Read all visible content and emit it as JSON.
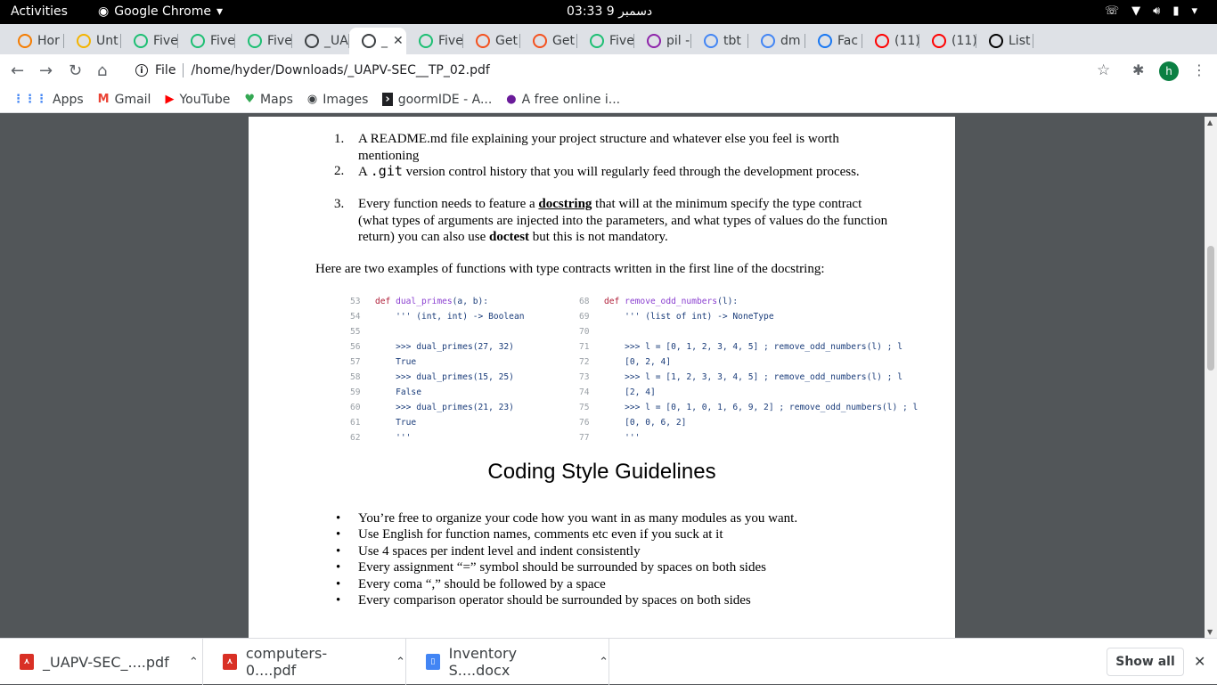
{
  "system": {
    "activities": "Activities",
    "app_name": "Google Chrome",
    "clock": "03:33 9 دسمبر"
  },
  "tabs": [
    {
      "label": "Hor",
      "color": "#f57c00"
    },
    {
      "label": "Unt",
      "color": "#f4b400"
    },
    {
      "label": "Five",
      "color": "#1dbf73"
    },
    {
      "label": "Five",
      "color": "#1dbf73"
    },
    {
      "label": "Five",
      "color": "#1dbf73"
    },
    {
      "label": "_UA",
      "color": "#3c4043"
    },
    {
      "label": "_",
      "color": "#3c4043"
    },
    {
      "label": "Five",
      "color": "#1dbf73"
    },
    {
      "label": "Get",
      "color": "#f4511e"
    },
    {
      "label": "Get",
      "color": "#f4511e"
    },
    {
      "label": "Five",
      "color": "#1dbf73"
    },
    {
      "label": "pil -",
      "color": "#8e24aa"
    },
    {
      "label": "tbt",
      "color": "#4285f4"
    },
    {
      "label": "dm",
      "color": "#4285f4"
    },
    {
      "label": "Fac",
      "color": "#1877f2"
    },
    {
      "label": "(11)",
      "color": "#ff0000"
    },
    {
      "label": "(11)",
      "color": "#ff0000"
    },
    {
      "label": "List",
      "color": "#000000"
    }
  ],
  "address": {
    "scheme_label": "File",
    "url": "/home/hyder/Downloads/_UAPV-SEC__TP_02.pdf"
  },
  "profile_initial": "h",
  "bookmarks": [
    {
      "label": "Apps"
    },
    {
      "label": "Gmail"
    },
    {
      "label": "YouTube"
    },
    {
      "label": "Maps"
    },
    {
      "label": "Images"
    },
    {
      "label": "goormIDE - A..."
    },
    {
      "label": "A free online i..."
    }
  ],
  "doc": {
    "ol": [
      {
        "num": "1.",
        "pre": "A README.md file explaining your project structure and whatever else you feel is worth mentioning"
      },
      {
        "num": "2.",
        "pre": "A ",
        "code": ".git",
        "post": " version control history that you will regularly feed through the development process."
      },
      {
        "num": "3.",
        "pre": "Every function needs to feature a ",
        "bold_u": "docstring",
        "mid": " that will at the minimum specify the type contract (what types of arguments are injected into the parameters, and what types of values do the function return) you can also use ",
        "bold": "doctest",
        "post": " but this is not mandatory."
      }
    ],
    "intro": "Here are two examples of functions with type contracts written in the first line of the docstring:",
    "code_left": [
      {
        "ln": "53",
        "kw": "def ",
        "fn": "dual_primes",
        "rest": "(a, b):"
      },
      {
        "ln": "54",
        "rest": "    ''' (int, int) -> Boolean"
      },
      {
        "ln": "55",
        "rest": ""
      },
      {
        "ln": "56",
        "rest": "    >>> dual_primes(27, 32)"
      },
      {
        "ln": "57",
        "rest": "    True"
      },
      {
        "ln": "58",
        "rest": "    >>> dual_primes(15, 25)"
      },
      {
        "ln": "59",
        "rest": "    False"
      },
      {
        "ln": "60",
        "rest": "    >>> dual_primes(21, 23)"
      },
      {
        "ln": "61",
        "rest": "    True"
      },
      {
        "ln": "62",
        "rest": "    '''"
      }
    ],
    "code_right": [
      {
        "ln": "68",
        "kw": "def ",
        "fn": "remove_odd_numbers",
        "rest": "(l):"
      },
      {
        "ln": "69",
        "rest": "    ''' (list of int) -> NoneType"
      },
      {
        "ln": "70",
        "rest": ""
      },
      {
        "ln": "71",
        "rest": "    >>> l = [0, 1, 2, 3, 4, 5] ; remove_odd_numbers(l) ; l"
      },
      {
        "ln": "72",
        "rest": "    [0, 2, 4]"
      },
      {
        "ln": "73",
        "rest": "    >>> l = [1, 2, 3, 3, 4, 5] ; remove_odd_numbers(l) ; l"
      },
      {
        "ln": "74",
        "rest": "    [2, 4]"
      },
      {
        "ln": "75",
        "rest": "    >>> l = [0, 1, 0, 1, 6, 9, 2] ; remove_odd_numbers(l) ; l"
      },
      {
        "ln": "76",
        "rest": "    [0, 0, 6, 2]"
      },
      {
        "ln": "77",
        "rest": "    '''"
      }
    ],
    "heading": "Coding Style Guidelines",
    "bullets": [
      "You’re free to organize your code how you want in as many modules as you want.",
      "Use English for function names, comments etc even if you suck at it",
      "Use 4 spaces per indent level and indent consistently",
      "Every assignment “=” symbol should be surrounded by spaces on both sides",
      "Every coma “,” should be followed by a space",
      "Every comparison operator should be surrounded by spaces on both sides"
    ]
  },
  "downloads": {
    "items": [
      {
        "label": "_UAPV-SEC_....pdf",
        "color": "#d93025"
      },
      {
        "label": "computers-0....pdf",
        "color": "#d93025"
      },
      {
        "label": "Inventory S....docx",
        "color": "#4285f4"
      }
    ],
    "show_all": "Show all"
  }
}
